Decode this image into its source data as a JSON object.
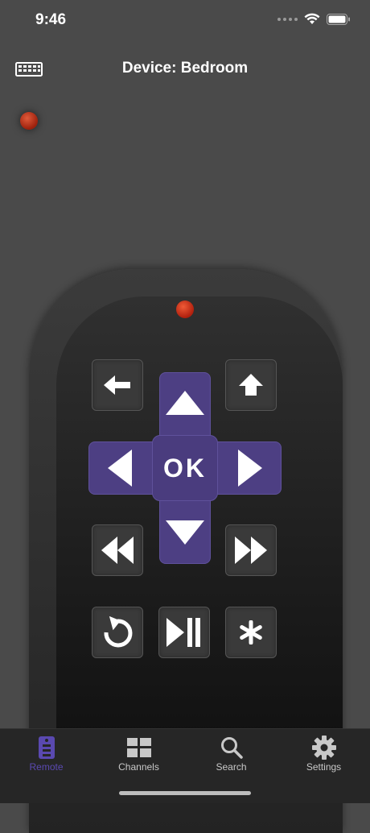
{
  "status_bar": {
    "time": "9:46"
  },
  "header": {
    "title": "Device: Bedroom",
    "keyboard_icon": "keyboard-icon"
  },
  "remote": {
    "ok_label": "OK",
    "buttons": [
      "back",
      "home",
      "up",
      "left",
      "right",
      "down",
      "rewind",
      "fast-forward",
      "replay",
      "play-pause",
      "options"
    ]
  },
  "tabs": [
    {
      "label": "Remote",
      "icon": "remote-icon",
      "active": true
    },
    {
      "label": "Channels",
      "icon": "grid-icon",
      "active": false
    },
    {
      "label": "Search",
      "icon": "search-icon",
      "active": false
    },
    {
      "label": "Settings",
      "icon": "gear-icon",
      "active": false
    }
  ],
  "colors": {
    "accent": "#5a49b0",
    "dpad": "#4d3f83",
    "background": "#4a4a4a",
    "led": "#c0280e"
  }
}
